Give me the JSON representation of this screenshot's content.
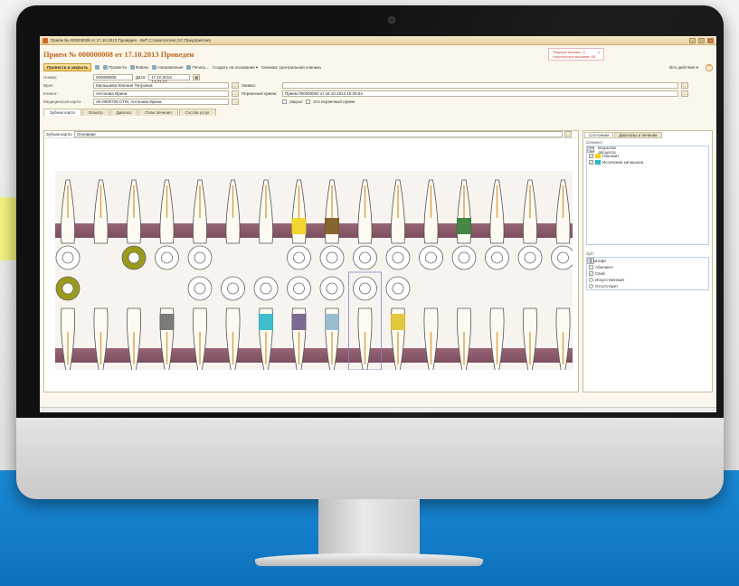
{
  "window": {
    "title": "Прием № 000000008 от 17.10.2013 Проведен - БИТ.Стоматология (1С:Предприятие)"
  },
  "doc": {
    "title": "Прием № 000000008 от 17.10.2013 Проведен",
    "alert_line1": "Текущие вызовы: 3",
    "alert_line2": "Неуспешных вызовов: 68",
    "alert_close": "x"
  },
  "toolbar": {
    "post_close": "Провести и закрыть",
    "post": "Провести",
    "files": "Файлы",
    "referral": "Направление",
    "print": "Печать...",
    "create_based": "Создать на основании ▾",
    "clinic": "Клиника: Центральная клиника",
    "all_actions": "Все действия ▾",
    "help": "?"
  },
  "form": {
    "number_label": "Номер:",
    "number_value": "000000008",
    "date_label": "Дата:",
    "date_value": "17.10.2013 14:22:47",
    "doctor_label": "Врач:",
    "doctor_value": "Малышева Евгения Петровна",
    "order_label": "Заявка:",
    "client_label": "Клиент:",
    "client_value": "Антонова Ирина",
    "first_visit_label": "Первичный прием:",
    "first_visit_value": "Прием 000000002 от 16.10.2013 15:25:54",
    "medcard_label": "Медицинская карта:",
    "medcard_value": "АК-0000725-СТМ, Антонова Ирина",
    "closed_label": "Закрыт",
    "primary_label": "Это первичный прием"
  },
  "tabs": [
    "Зубная карта",
    "Осмотр",
    "Диагноз",
    "План лечения",
    "Состав услуг"
  ],
  "chart_panel": {
    "label": "Зубная карта:",
    "value": "Основная"
  },
  "right_panel": {
    "tabs": [
      "Состояния",
      "Диагнозы и лечение"
    ],
    "segment_label": "Сегмент:",
    "segments": [
      {
        "label": "Вскрытие абсцесса",
        "color": "#8b1a1a",
        "checked": true
      },
      {
        "label": "Гингивит",
        "color": "#f2d21c",
        "checked": true
      },
      {
        "label": "Иссечение капюшона",
        "color": "#2bb7c7",
        "checked": true
      }
    ],
    "tooth_label": "Зуб:",
    "tooth_states": [
      {
        "label": "Штифт",
        "kind": "checkbox",
        "checked": false,
        "selected": true
      },
      {
        "label": "Абатмент",
        "kind": "checkbox",
        "checked": false
      },
      {
        "label": "Свой",
        "kind": "radio",
        "checked": true
      },
      {
        "label": "Искусственный",
        "kind": "radio",
        "checked": false
      },
      {
        "label": "Отсутствует",
        "kind": "radio",
        "checked": false
      }
    ]
  },
  "colors": {
    "accent": "#c0651d",
    "gum": "#7a4558",
    "crown_yellow": "#f2d21c",
    "crown_cyan": "#2bb7c7",
    "olive": "#9a9a1a"
  }
}
